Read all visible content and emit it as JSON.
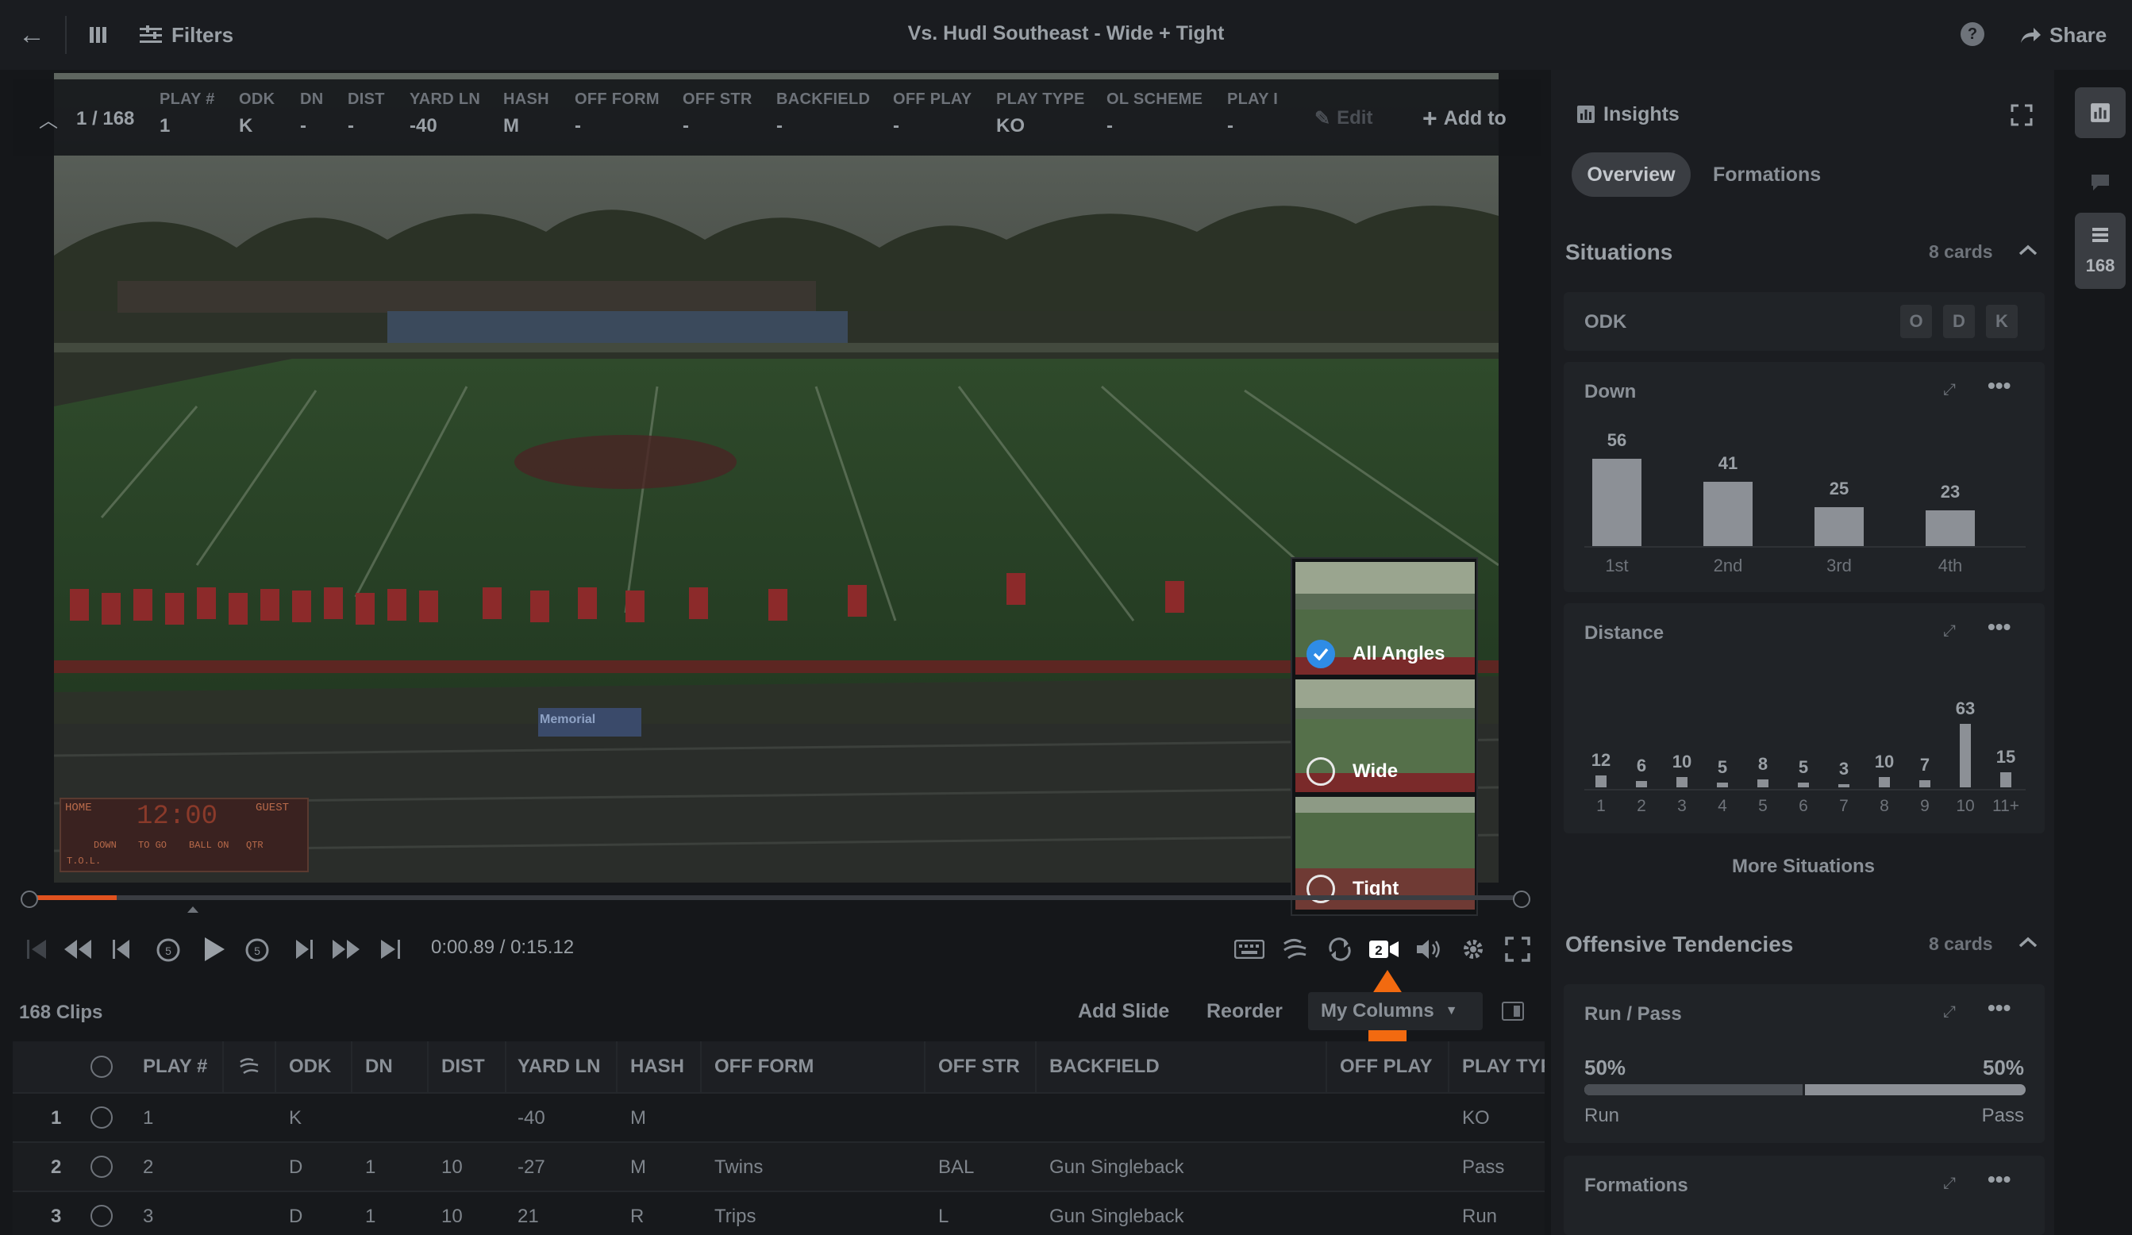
{
  "topbar": {
    "title": "Vs. Hudl Southeast - Wide + Tight",
    "filters_label": "Filters",
    "share_label": "Share"
  },
  "playinfo": {
    "counter": "1 / 168",
    "columns": [
      {
        "header": "PLAY #",
        "value": "1"
      },
      {
        "header": "ODK",
        "value": "K"
      },
      {
        "header": "DN",
        "value": "-"
      },
      {
        "header": "DIST",
        "value": "-"
      },
      {
        "header": "YARD LN",
        "value": "-40"
      },
      {
        "header": "HASH",
        "value": "M"
      },
      {
        "header": "OFF FORM",
        "value": "-"
      },
      {
        "header": "OFF STR",
        "value": "-"
      },
      {
        "header": "BACKFIELD",
        "value": "-"
      },
      {
        "header": "OFF PLAY",
        "value": "-"
      },
      {
        "header": "PLAY TYPE",
        "value": "KO"
      },
      {
        "header": "OL SCHEME",
        "value": "-"
      },
      {
        "header": "PLAY I",
        "value": "-"
      }
    ],
    "edit_label": "Edit",
    "add_label": "Add to"
  },
  "scoreboard": {
    "home": "HOME",
    "guest": "GUEST",
    "clock": "12:00",
    "down": "DOWN",
    "togo": "TO GO",
    "ballon": "BALL ON",
    "qtr": "QTR",
    "tol": "T.O.L.",
    "sponsor": "Memorial"
  },
  "angles": [
    {
      "label": "All Angles",
      "selected": true
    },
    {
      "label": "Wide",
      "selected": false
    },
    {
      "label": "Tight",
      "selected": false
    }
  ],
  "player": {
    "timecode": "0:00.89 / 0:15.12",
    "progress": 0.059,
    "angle_badge": "2"
  },
  "clips": {
    "count_label": "168 Clips",
    "add_slide": "Add Slide",
    "reorder": "Reorder",
    "columns_dropdown": "My Columns",
    "headers": [
      "PLAY #",
      "ODK",
      "DN",
      "DIST",
      "YARD LN",
      "HASH",
      "OFF FORM",
      "OFF STR",
      "BACKFIELD",
      "OFF PLAY",
      "PLAY TYPE"
    ],
    "rows": [
      {
        "index": "1",
        "play": "1",
        "odk": "K",
        "dn": "",
        "dist": "",
        "yard": "-40",
        "hash": "M",
        "form": "",
        "str": "",
        "back": "",
        "offplay": "",
        "type": "KO"
      },
      {
        "index": "2",
        "play": "2",
        "odk": "D",
        "dn": "1",
        "dist": "10",
        "yard": "-27",
        "hash": "M",
        "form": "Twins",
        "str": "BAL",
        "back": "Gun Singleback",
        "offplay": "",
        "type": "Pass"
      },
      {
        "index": "3",
        "play": "3",
        "odk": "D",
        "dn": "1",
        "dist": "10",
        "yard": "21",
        "hash": "R",
        "form": "Trips",
        "str": "L",
        "back": "Gun Singleback",
        "offplay": "",
        "type": "Run"
      }
    ]
  },
  "insights": {
    "title": "Insights",
    "tabs": [
      "Overview",
      "Formations"
    ],
    "situations": {
      "title": "Situations",
      "count": "8 cards"
    },
    "odk": {
      "label": "ODK",
      "buttons": [
        "O",
        "D",
        "K"
      ]
    },
    "more_situations": "More Situations",
    "offensive": {
      "title": "Offensive Tendencies",
      "count": "8 cards"
    },
    "runpass": {
      "title": "Run / Pass",
      "run_pct": "50%",
      "pass_pct": "50%",
      "run_label": "Run",
      "pass_label": "Pass",
      "run_fraction": 0.5
    },
    "formations_title": "Formations"
  },
  "rail": {
    "count": "168"
  },
  "chart_data": [
    {
      "type": "bar",
      "title": "Down",
      "categories": [
        "1st",
        "2nd",
        "3rd",
        "4th"
      ],
      "values": [
        56,
        41,
        25,
        23
      ]
    },
    {
      "type": "bar",
      "title": "Distance",
      "categories": [
        "1",
        "2",
        "3",
        "4",
        "5",
        "6",
        "7",
        "8",
        "9",
        "10",
        "11+"
      ],
      "values": [
        12,
        6,
        10,
        5,
        8,
        5,
        3,
        10,
        7,
        63,
        15
      ]
    }
  ],
  "colors": {
    "accent": "#2f8ce6",
    "arrow": "#f26a10",
    "scrub": "#e0521f"
  }
}
